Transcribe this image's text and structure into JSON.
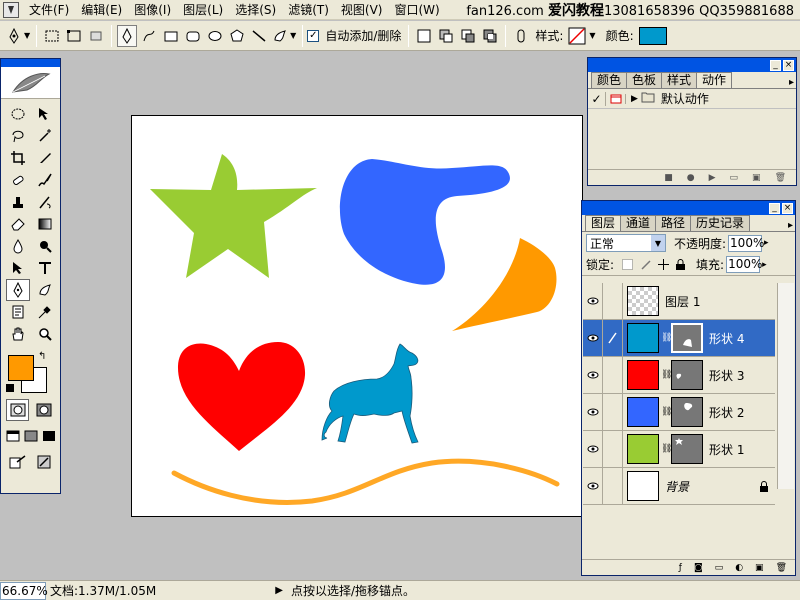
{
  "menu": [
    "文件(F)",
    "编辑(E)",
    "图像(I)",
    "图层(L)",
    "选择(S)",
    "滤镜(T)",
    "视图(V)",
    "窗口(W)"
  ],
  "watermark": {
    "site": "fan126.com",
    "brand": "爱闪教程",
    "phone": "13081658396",
    "qq": "QQ359881688"
  },
  "options": {
    "auto_add_delete": "自动添加/删除",
    "style_label": "样式:",
    "color_label": "颜色:",
    "color": "#0099cc"
  },
  "actions_panel": {
    "tabs": [
      "颜色",
      "色板",
      "样式",
      "动作"
    ],
    "active_tab": 3,
    "default_set": "默认动作"
  },
  "layers_panel": {
    "tabs": [
      "图层",
      "通道",
      "路径",
      "历史记录"
    ],
    "active_tab": 0,
    "blend_mode": "正常",
    "opacity_label": "不透明度:",
    "opacity": "100%",
    "lock_label": "锁定:",
    "fill_label": "填充:",
    "fill": "100%",
    "layers": [
      {
        "name": "图层 1",
        "fill": "transparent",
        "selected": false
      },
      {
        "name": "形状 4",
        "fill": "#0099cc",
        "selected": true
      },
      {
        "name": "形状 3",
        "fill": "#ff0000",
        "selected": false
      },
      {
        "name": "形状 2",
        "fill": "#3366ff",
        "selected": false
      },
      {
        "name": "形状 1",
        "fill": "#99cc33",
        "selected": false
      },
      {
        "name": "背景",
        "fill": "#ffffff",
        "selected": false
      }
    ]
  },
  "toolbox": {
    "fg_color": "#ff9900",
    "bg_color": "#ffffff"
  },
  "canvas": {
    "shapes": [
      {
        "name": "green-star-shape",
        "color": "#99cc33"
      },
      {
        "name": "blue-blob-shape",
        "color": "#3366ff"
      },
      {
        "name": "orange-wedge-shape",
        "color": "#ff9900"
      },
      {
        "name": "red-heart-shape",
        "color": "#ff0000"
      },
      {
        "name": "dog-shape",
        "color": "#0099cc"
      },
      {
        "name": "orange-stroke-path",
        "color": "#ff9900"
      }
    ]
  },
  "status": {
    "zoom": "66.67%",
    "doc": "文档:1.37M/1.05M",
    "hint": "点按以选择/拖移锚点。"
  }
}
